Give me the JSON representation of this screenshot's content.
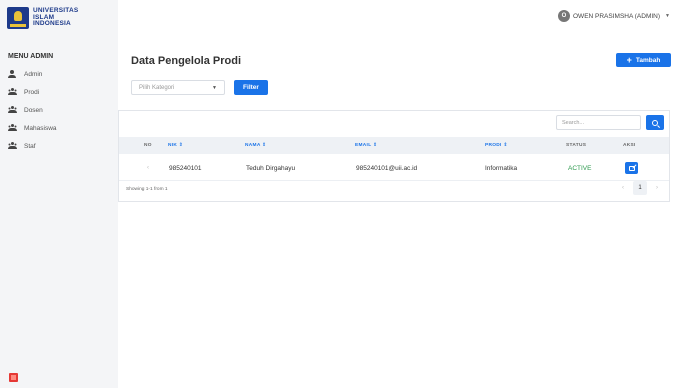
{
  "brand": {
    "line1": "UNIVERSITAS",
    "line2": "ISLAM",
    "line3": "INDONESIA"
  },
  "user": {
    "initial": "O",
    "name": "OWEN PRASIMSHA (ADMIN)"
  },
  "sidebar": {
    "title": "MENU ADMIN",
    "items": [
      {
        "label": "Admin",
        "icon": "user-icon"
      },
      {
        "label": "Prodi",
        "icon": "users-icon"
      },
      {
        "label": "Dosen",
        "icon": "users-icon"
      },
      {
        "label": "Mahasiswa",
        "icon": "users-icon"
      },
      {
        "label": "Staf",
        "icon": "users-icon"
      }
    ]
  },
  "page": {
    "title": "Data Pengelola Prodi",
    "add_label": "Tambah",
    "category_placeholder": "Pilih Kategori",
    "filter_label": "Filter",
    "search_placeholder": "Search..."
  },
  "table": {
    "headers": [
      "NO",
      "NIK ⇕",
      "NAMA ⇕",
      "EMAIL ⇕",
      "PRODI ⇕",
      "STATUS",
      "AKSI"
    ],
    "rows": [
      {
        "no": "‹",
        "nik": "985240101",
        "nama": "Teduh Dirgahayu",
        "email": "985240101@uii.ac.id",
        "prodi": "Informatika",
        "status": "ACTIVE"
      }
    ],
    "info": "Showing 1-1 from 1",
    "pagination": {
      "prev": "‹",
      "current": "1",
      "next": "›"
    }
  },
  "colors": {
    "primary": "#1a73e8",
    "active": "#2e9a4f",
    "brand": "#1d3a8a"
  }
}
